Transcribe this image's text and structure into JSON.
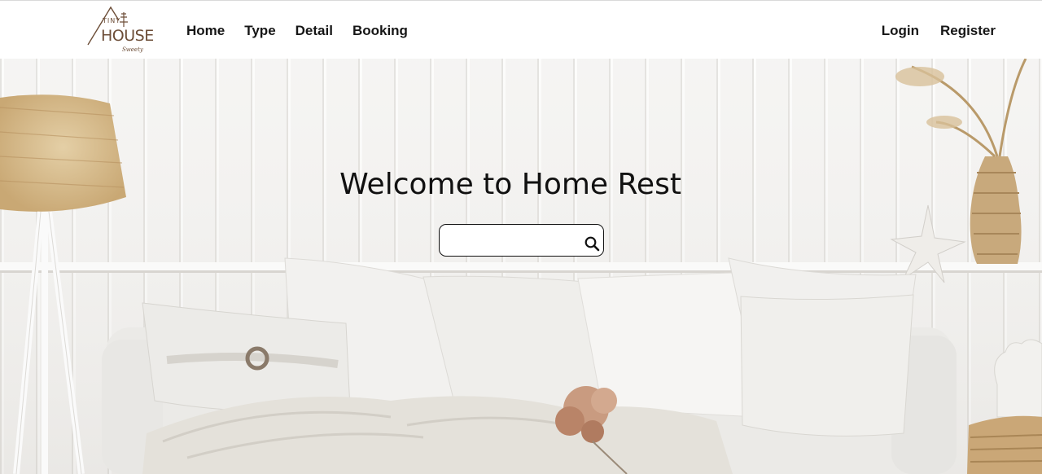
{
  "logo": {
    "line1": "TINY",
    "line2": "HOUSE",
    "line3": "Sweety"
  },
  "nav": {
    "left": [
      "Home",
      "Type",
      "Detail",
      "Booking"
    ],
    "right": [
      "Login",
      "Register"
    ]
  },
  "hero": {
    "title": "Welcome to Home Rest",
    "search": {
      "placeholder": "",
      "value": ""
    }
  },
  "colors": {
    "logo_brown": "#6d4e38",
    "nav_text": "#161616",
    "hero_bg": "#f4f3f1"
  }
}
